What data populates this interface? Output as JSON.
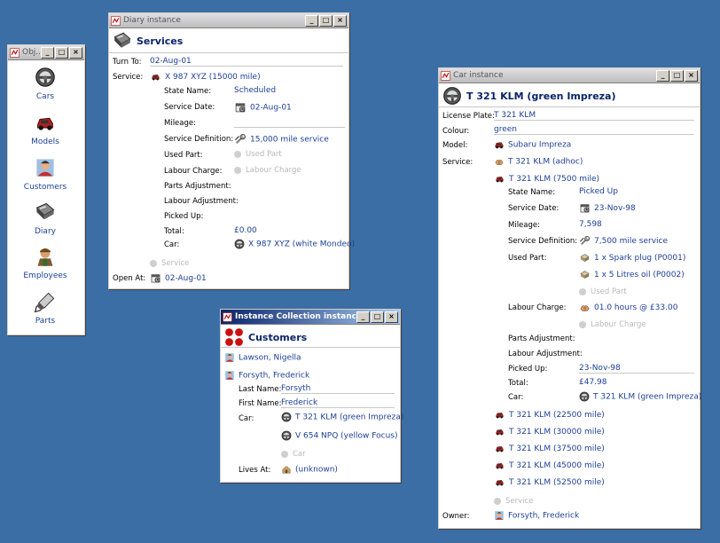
{
  "colors": {
    "desktop": "#3a6ea5",
    "link": "#1c3f94",
    "active_title": "#0a246a"
  },
  "objects_window": {
    "title": "Obj...",
    "items": [
      {
        "label": "Cars",
        "icon": "steering-wheel-icon"
      },
      {
        "label": "Models",
        "icon": "red-car-icon"
      },
      {
        "label": "Customers",
        "icon": "customer-person-icon"
      },
      {
        "label": "Diary",
        "icon": "diary-book-icon"
      },
      {
        "label": "Employees",
        "icon": "employee-mechanic-icon"
      },
      {
        "label": "Parts",
        "icon": "spark-plug-icon"
      }
    ]
  },
  "diary_window": {
    "title": "Diary instance",
    "header": "Services",
    "turn_to_label": "Turn To:",
    "turn_to_value": "02-Aug-01",
    "service_label": "Service:",
    "service_value": "X 987 XYZ (15000 mile)",
    "state_name_label": "State Name:",
    "state_name_value": "Scheduled",
    "service_date_label": "Service Date:",
    "service_date_value": "02-Aug-01",
    "mileage_label": "Mileage:",
    "service_def_label": "Service Definition:",
    "service_def_value": "15,000 mile service",
    "used_part_label": "Used Part:",
    "used_part_value": "Used Part",
    "labour_charge_label": "Labour Charge:",
    "labour_charge_value": "Labour Charge",
    "parts_adj_label": "Parts Adjustment:",
    "labour_adj_label": "Labour Adjustment:",
    "picked_up_label": "Picked Up:",
    "total_label": "Total:",
    "total_value": "£0.00",
    "car_label": "Car:",
    "car_value": "X 987 XYZ (white Mondeo)",
    "service_placeholder": "Service",
    "open_at_label": "Open At:",
    "open_at_value": "02-Aug-01"
  },
  "collection_window": {
    "title": "Instance Collection instance",
    "header": "Customers",
    "customer1": "Lawson, Nigella",
    "customer2": "Forsyth, Frederick",
    "last_name_label": "Last Name:",
    "last_name_value": "Forsyth",
    "first_name_label": "First Name:",
    "first_name_value": "Frederick",
    "car_label": "Car:",
    "car1": "T 321 KLM (green Impreza)",
    "car2": "V 654 NPQ (yellow Focus)",
    "car_placeholder": "Car",
    "lives_at_label": "Lives At:",
    "lives_at_value": "(unknown)"
  },
  "car_window": {
    "title": "Car instance",
    "header": "T 321 KLM (green Impreza)",
    "license_label": "License Plate:",
    "license_value": "T 321 KLM",
    "colour_label": "Colour:",
    "colour_value": "green",
    "model_label": "Model:",
    "model_value": "Subaru Impreza",
    "service_label": "Service:",
    "svc_adhoc": "T 321 KLM (adhoc)",
    "svc_7500": "T 321 KLM (7500 mile)",
    "state_name_label": "State Name:",
    "state_name_value": "Picked Up",
    "service_date_label": "Service Date:",
    "service_date_value": "23-Nov-98",
    "mileage_label": "Mileage:",
    "mileage_value": "7,598",
    "service_def_label": "Service Definition:",
    "service_def_value": "7,500 mile service",
    "used_part_label": "Used Part:",
    "part1": "1 x Spark plug (P0001)",
    "part2": "1 x 5 Litres oil (P0002)",
    "used_part_placeholder": "Used Part",
    "labour_charge_label": "Labour Charge:",
    "labour_charge_value": "01.0 hours @ £33.00",
    "labour_charge_placeholder": "Labour Charge",
    "parts_adj_label": "Parts Adjustment:",
    "labour_adj_label": "Labour Adjustment:",
    "picked_up_label": "Picked Up:",
    "picked_up_value": "23-Nov-98",
    "total_label": "Total:",
    "total_value": "£47.98",
    "car_label": "Car:",
    "car_value": "T 321 KLM (green Impreza)",
    "svc_22500": "T 321 KLM (22500 mile)",
    "svc_30000": "T 321 KLM (30000 mile)",
    "svc_37500": "T 321 KLM (37500 mile)",
    "svc_45000": "T 321 KLM (45000 mile)",
    "svc_52500": "T 321 KLM (52500 mile)",
    "service_placeholder": "Service",
    "owner_label": "Owner:",
    "owner_value": "Forsyth, Frederick"
  }
}
